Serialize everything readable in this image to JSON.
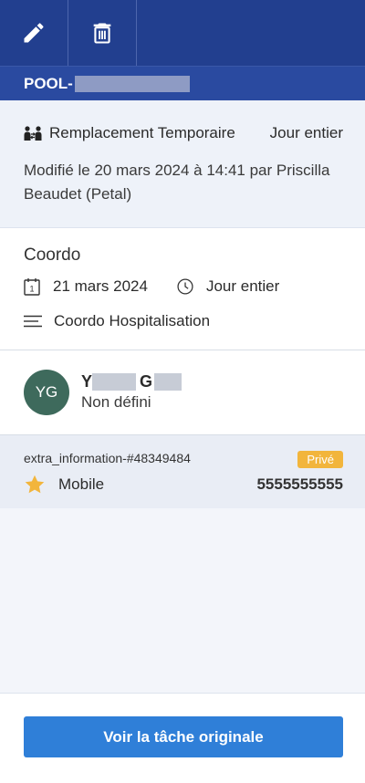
{
  "toolbar": {
    "edit_icon": "pencil-icon",
    "delete_icon": "trash-icon"
  },
  "pool": {
    "label": "POOL-"
  },
  "info": {
    "type_icon": "people-swap-icon",
    "type_label": "Remplacement Temporaire",
    "duration_label": "Jour entier",
    "modified_text": "Modifié le 20 mars 2024 à 14:41 par Priscilla Beaudet (Petal)"
  },
  "task": {
    "title": "Coordo",
    "date_icon": "calendar-icon",
    "date_badge": "1",
    "date": "21 mars 2024",
    "time_icon": "clock-icon",
    "time": "Jour entier",
    "description_icon": "lines-icon",
    "description": "Coordo Hospitalisation"
  },
  "person": {
    "initials": "YG",
    "name_start": "Y",
    "name_mid": "G",
    "role": "Non défini"
  },
  "extra": {
    "id": "extra_information-#48349484",
    "badge": "Privé",
    "phone_icon": "star-icon",
    "phone_label": "Mobile",
    "phone_number": "5555555555"
  },
  "footer": {
    "button_label": "Voir la tâche originale"
  },
  "colors": {
    "header": "#223f8f",
    "pool_bar": "#2a4aa0",
    "avatar": "#3e6a5c",
    "badge": "#f2b53c",
    "star": "#f2b53c",
    "primary_button": "#2f7fd8"
  }
}
